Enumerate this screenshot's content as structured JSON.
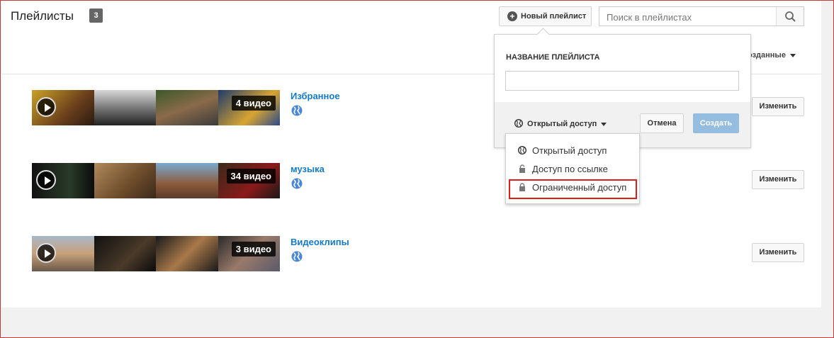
{
  "header": {
    "title": "Плейлисты",
    "count": "3"
  },
  "toolbar": {
    "new_playlist_label": "Новый плейлист",
    "search_placeholder": "Поиск в плейлистах"
  },
  "sort": {
    "label": "озданные"
  },
  "playlists": [
    {
      "name": "Избранное",
      "videos": "4 видео",
      "edit_label": "Изменить"
    },
    {
      "name": "музыка",
      "videos": "34 видео",
      "edit_label": "Изменить"
    },
    {
      "name": "Видеоклипы",
      "videos": "3 видео",
      "edit_label": "Изменить"
    }
  ],
  "popup": {
    "field_label": "НАЗВАНИЕ ПЛЕЙЛИСТА",
    "privacy_label": "Открытый доступ",
    "cancel_label": "Отмена",
    "create_label": "Создать"
  },
  "privacy_menu": [
    {
      "label": "Открытый доступ",
      "icon": "globe-icon"
    },
    {
      "label": "Доступ по ссылке",
      "icon": "lock-icon"
    },
    {
      "label": "Ограниченный доступ",
      "icon": "lock-icon"
    }
  ],
  "colors": {
    "link": "#167ac6",
    "highlight": "#e21b1b",
    "create_button": "#95bde0"
  }
}
